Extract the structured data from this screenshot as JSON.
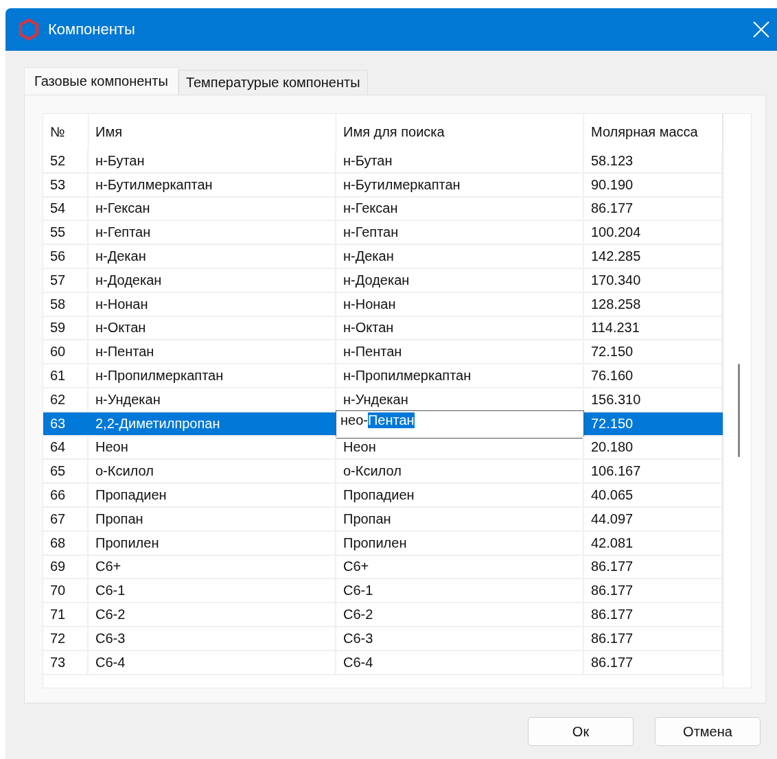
{
  "window": {
    "title": "Компоненты"
  },
  "tabs": [
    {
      "label": "Газовые компоненты",
      "selected": true
    },
    {
      "label": "Температурые компоненты",
      "selected": false
    }
  ],
  "table": {
    "columns": [
      "№",
      "Имя",
      "Имя для поиска",
      "Молярная масса"
    ],
    "rows": [
      {
        "no": "52",
        "name": "н-Бутан",
        "search_name": "н-Бутан",
        "molar_mass": "58.123",
        "selected": false
      },
      {
        "no": "53",
        "name": "н-Бутилмеркаптан",
        "search_name": "н-Бутилмеркаптан",
        "molar_mass": "90.190",
        "selected": false
      },
      {
        "no": "54",
        "name": "н-Гексан",
        "search_name": "н-Гексан",
        "molar_mass": "86.177",
        "selected": false
      },
      {
        "no": "55",
        "name": "н-Гептан",
        "search_name": "н-Гептан",
        "molar_mass": "100.204",
        "selected": false
      },
      {
        "no": "56",
        "name": "н-Декан",
        "search_name": "н-Декан",
        "molar_mass": "142.285",
        "selected": false
      },
      {
        "no": "57",
        "name": "н-Додекан",
        "search_name": "н-Додекан",
        "molar_mass": "170.340",
        "selected": false
      },
      {
        "no": "58",
        "name": "н-Нонан",
        "search_name": "н-Нонан",
        "molar_mass": "128.258",
        "selected": false
      },
      {
        "no": "59",
        "name": "н-Октан",
        "search_name": "н-Октан",
        "molar_mass": "114.231",
        "selected": false
      },
      {
        "no": "60",
        "name": "н-Пентан",
        "search_name": "н-Пентан",
        "molar_mass": "72.150",
        "selected": false
      },
      {
        "no": "61",
        "name": "н-Пропилмеркаптан",
        "search_name": "н-Пропилмеркаптан",
        "molar_mass": "76.160",
        "selected": false
      },
      {
        "no": "62",
        "name": "н-Ундекан",
        "search_name": "н-Ундекан",
        "molar_mass": "156.310",
        "selected": false
      },
      {
        "no": "63",
        "name": "2,2-Диметилпропан",
        "search_editor": {
          "text": "нео-",
          "highlighted_text": "Пентан"
        },
        "molar_mass": "72.150",
        "selected": true
      },
      {
        "no": "64",
        "name": "Неон",
        "search_name": "Неон",
        "molar_mass": "20.180",
        "selected": false
      },
      {
        "no": "65",
        "name": "о-Ксилол",
        "search_name": "о-Ксилол",
        "molar_mass": "106.167",
        "selected": false
      },
      {
        "no": "66",
        "name": "Пропадиен",
        "search_name": "Пропадиен",
        "molar_mass": "40.065",
        "selected": false
      },
      {
        "no": "67",
        "name": "Пропан",
        "search_name": "Пропан",
        "molar_mass": "44.097",
        "selected": false
      },
      {
        "no": "68",
        "name": "Пропилен",
        "search_name": "Пропилен",
        "molar_mass": "42.081",
        "selected": false
      },
      {
        "no": "69",
        "name": "C6+",
        "search_name": "C6+",
        "molar_mass": "86.177",
        "selected": false
      },
      {
        "no": "70",
        "name": "C6-1",
        "search_name": "C6-1",
        "molar_mass": "86.177",
        "selected": false
      },
      {
        "no": "71",
        "name": "C6-2",
        "search_name": "C6-2",
        "molar_mass": "86.177",
        "selected": false
      },
      {
        "no": "72",
        "name": "C6-3",
        "search_name": "C6-3",
        "molar_mass": "86.177",
        "selected": false
      },
      {
        "no": "73",
        "name": "C6-4",
        "search_name": "C6-4",
        "molar_mass": "86.177",
        "selected": false
      }
    ]
  },
  "buttons": [
    "Ок",
    "Отмена"
  ]
}
